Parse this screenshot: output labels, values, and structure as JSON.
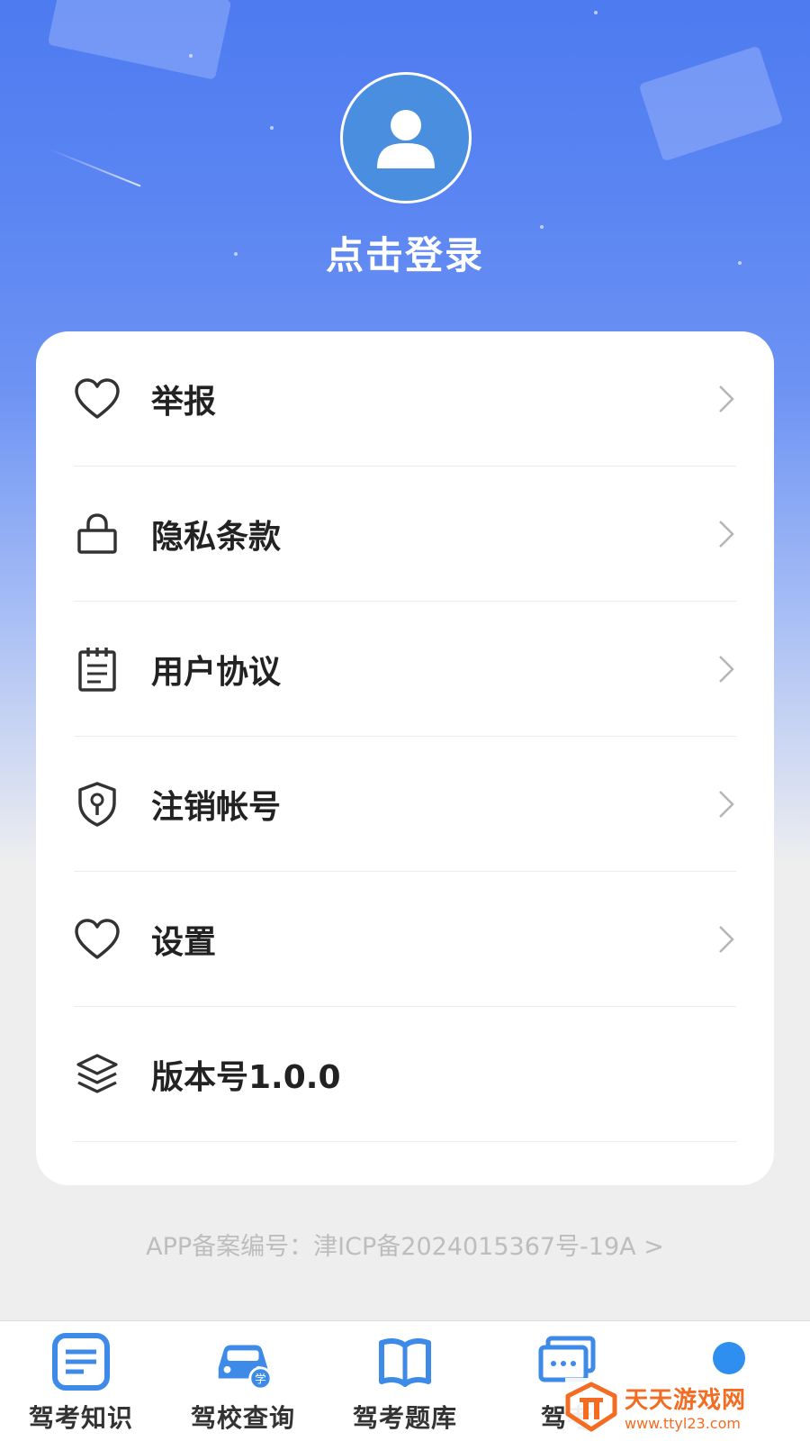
{
  "profile": {
    "login_label": "点击登录"
  },
  "menu": {
    "items": [
      {
        "label": "举报",
        "icon": "heart-icon"
      },
      {
        "label": "隐私条款",
        "icon": "lock-icon"
      },
      {
        "label": "用户协议",
        "icon": "notepad-icon"
      },
      {
        "label": "注销帐号",
        "icon": "shield-key-icon"
      },
      {
        "label": "设置",
        "icon": "heart-icon"
      },
      {
        "label": "版本号1.0.0",
        "icon": "layers-icon"
      }
    ]
  },
  "footer": {
    "icp_text": "APP备案编号：津ICP备2024015367号-19A >"
  },
  "tabbar": {
    "tabs": [
      {
        "label": "驾考知识",
        "icon": "document-icon"
      },
      {
        "label": "驾校查询",
        "icon": "car-icon"
      },
      {
        "label": "驾考题库",
        "icon": "book-icon"
      },
      {
        "label": "驾考",
        "icon": "chat-icon"
      },
      {
        "label": "",
        "icon": "profile-icon"
      }
    ]
  },
  "watermark": {
    "name": "天天游戏网",
    "url": "www.ttyl23.com"
  },
  "colors": {
    "accent": "#4a8ee0",
    "hero_top": "#4d7bf0",
    "watermark": "#f36c21"
  }
}
